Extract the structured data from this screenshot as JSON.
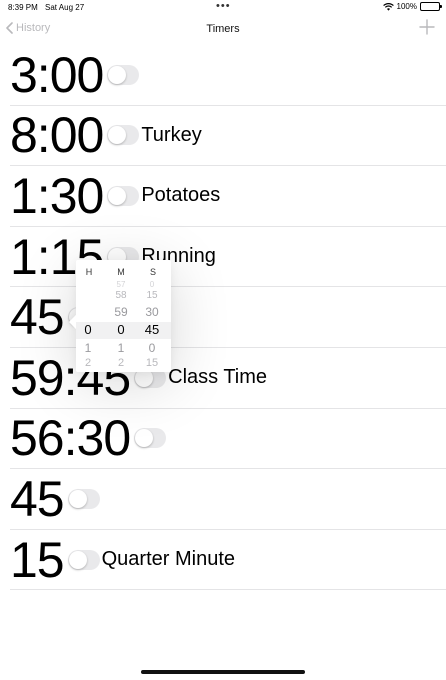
{
  "status_bar": {
    "time": "8:39 PM",
    "date": "Sat Aug 27",
    "dots": "•••",
    "battery_text": "100%",
    "icons": [
      "wifi-icon",
      "battery-icon"
    ]
  },
  "nav": {
    "back_label": "History",
    "title": "Timers",
    "add_icon": "plus-icon"
  },
  "timers": [
    {
      "value": "3:00",
      "label": "",
      "enabled": false
    },
    {
      "value": "8:00",
      "label": "Turkey",
      "enabled": false
    },
    {
      "value": "1:30",
      "label": "Potatoes",
      "enabled": false
    },
    {
      "value": "1:15",
      "label": "Running",
      "enabled": false
    },
    {
      "value": "45",
      "label": "",
      "enabled": false
    },
    {
      "value": "59:45",
      "label": "Class Time",
      "enabled": false
    },
    {
      "value": "56:30",
      "label": "",
      "enabled": false
    },
    {
      "value": "45",
      "label": "",
      "enabled": false
    },
    {
      "value": "15",
      "label": "Quarter Minute",
      "enabled": false
    }
  ],
  "picker": {
    "headers": [
      "H",
      "M",
      "S"
    ],
    "hours": [
      "",
      "",
      "",
      "0",
      "1",
      "2"
    ],
    "minutes": [
      "57",
      "58",
      "59",
      "0",
      "1",
      "2"
    ],
    "seconds": [
      "0",
      "15",
      "30",
      "45",
      "0",
      "15"
    ],
    "selected": {
      "hours": "0",
      "minutes": "0",
      "seconds": "45"
    }
  },
  "colors": {
    "toggle_off": "#e9e9eb",
    "separator": "#e4e4e6",
    "nav_inactive": "#b9b9bc"
  }
}
